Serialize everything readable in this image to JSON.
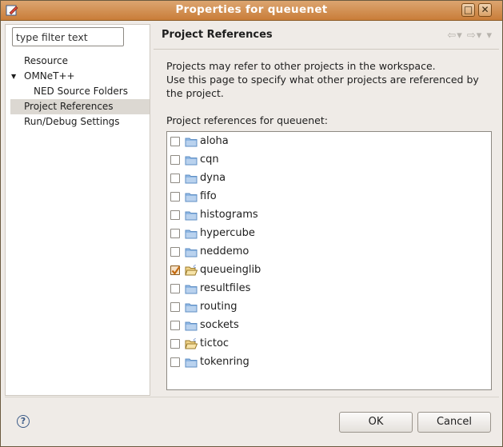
{
  "window": {
    "title": "Properties for queuenet"
  },
  "filter": {
    "value": "type filter text"
  },
  "tree": [
    {
      "label": "Resource",
      "indent": 1,
      "expanded": null,
      "selected": false
    },
    {
      "label": "OMNeT++",
      "indent": 1,
      "expanded": true,
      "selected": false
    },
    {
      "label": "NED Source Folders",
      "indent": 2,
      "expanded": null,
      "selected": false
    },
    {
      "label": "Project References",
      "indent": 1,
      "expanded": null,
      "selected": true
    },
    {
      "label": "Run/Debug Settings",
      "indent": 1,
      "expanded": null,
      "selected": false
    }
  ],
  "page": {
    "title": "Project References",
    "description_line1": "Projects may refer to other projects in the workspace.",
    "description_line2": "Use this page to specify what other projects are referenced by",
    "description_line3": "the project.",
    "list_label": "Project references for queuenet:"
  },
  "projects": [
    {
      "name": "aloha",
      "checked": false,
      "icon": "folder-icon"
    },
    {
      "name": "cqn",
      "checked": false,
      "icon": "folder-icon"
    },
    {
      "name": "dyna",
      "checked": false,
      "icon": "folder-icon"
    },
    {
      "name": "fifo",
      "checked": false,
      "icon": "folder-icon"
    },
    {
      "name": "histograms",
      "checked": false,
      "icon": "folder-icon"
    },
    {
      "name": "hypercube",
      "checked": false,
      "icon": "folder-icon"
    },
    {
      "name": "neddemo",
      "checked": false,
      "icon": "folder-icon"
    },
    {
      "name": "queueinglib",
      "checked": true,
      "icon": "open-project-icon"
    },
    {
      "name": "resultfiles",
      "checked": false,
      "icon": "folder-icon"
    },
    {
      "name": "routing",
      "checked": false,
      "icon": "folder-icon"
    },
    {
      "name": "sockets",
      "checked": false,
      "icon": "folder-icon"
    },
    {
      "name": "tictoc",
      "checked": false,
      "icon": "open-project-icon"
    },
    {
      "name": "tokenring",
      "checked": false,
      "icon": "folder-icon"
    }
  ],
  "buttons": {
    "ok": "OK",
    "cancel": "Cancel"
  },
  "colors": {
    "titlebar": "#c97d39",
    "selection": "#dcd8d2",
    "folder": "#5f8fc4",
    "check": "#c36a10"
  }
}
